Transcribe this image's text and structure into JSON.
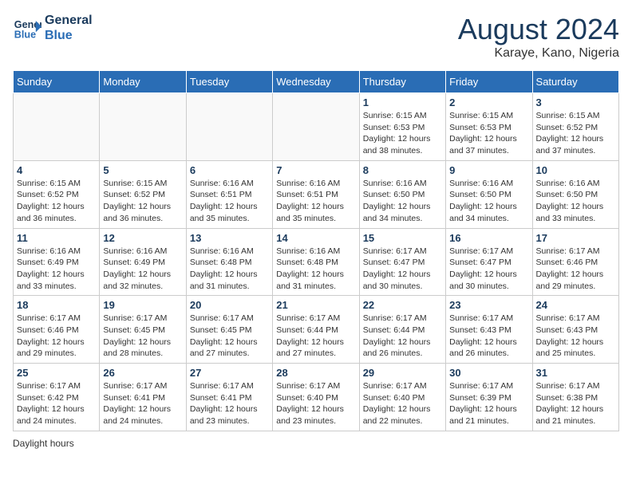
{
  "header": {
    "logo_line1": "General",
    "logo_line2": "Blue",
    "month_year": "August 2024",
    "location": "Karaye, Kano, Nigeria"
  },
  "days_of_week": [
    "Sunday",
    "Monday",
    "Tuesday",
    "Wednesday",
    "Thursday",
    "Friday",
    "Saturday"
  ],
  "weeks": [
    [
      {
        "day": null
      },
      {
        "day": null
      },
      {
        "day": null
      },
      {
        "day": null
      },
      {
        "day": 1,
        "sunrise": "6:15 AM",
        "sunset": "6:53 PM",
        "daylight": "12 hours and 38 minutes."
      },
      {
        "day": 2,
        "sunrise": "6:15 AM",
        "sunset": "6:53 PM",
        "daylight": "12 hours and 37 minutes."
      },
      {
        "day": 3,
        "sunrise": "6:15 AM",
        "sunset": "6:52 PM",
        "daylight": "12 hours and 37 minutes."
      }
    ],
    [
      {
        "day": 4,
        "sunrise": "6:15 AM",
        "sunset": "6:52 PM",
        "daylight": "12 hours and 36 minutes."
      },
      {
        "day": 5,
        "sunrise": "6:15 AM",
        "sunset": "6:52 PM",
        "daylight": "12 hours and 36 minutes."
      },
      {
        "day": 6,
        "sunrise": "6:16 AM",
        "sunset": "6:51 PM",
        "daylight": "12 hours and 35 minutes."
      },
      {
        "day": 7,
        "sunrise": "6:16 AM",
        "sunset": "6:51 PM",
        "daylight": "12 hours and 35 minutes."
      },
      {
        "day": 8,
        "sunrise": "6:16 AM",
        "sunset": "6:50 PM",
        "daylight": "12 hours and 34 minutes."
      },
      {
        "day": 9,
        "sunrise": "6:16 AM",
        "sunset": "6:50 PM",
        "daylight": "12 hours and 34 minutes."
      },
      {
        "day": 10,
        "sunrise": "6:16 AM",
        "sunset": "6:50 PM",
        "daylight": "12 hours and 33 minutes."
      }
    ],
    [
      {
        "day": 11,
        "sunrise": "6:16 AM",
        "sunset": "6:49 PM",
        "daylight": "12 hours and 33 minutes."
      },
      {
        "day": 12,
        "sunrise": "6:16 AM",
        "sunset": "6:49 PM",
        "daylight": "12 hours and 32 minutes."
      },
      {
        "day": 13,
        "sunrise": "6:16 AM",
        "sunset": "6:48 PM",
        "daylight": "12 hours and 31 minutes."
      },
      {
        "day": 14,
        "sunrise": "6:16 AM",
        "sunset": "6:48 PM",
        "daylight": "12 hours and 31 minutes."
      },
      {
        "day": 15,
        "sunrise": "6:17 AM",
        "sunset": "6:47 PM",
        "daylight": "12 hours and 30 minutes."
      },
      {
        "day": 16,
        "sunrise": "6:17 AM",
        "sunset": "6:47 PM",
        "daylight": "12 hours and 30 minutes."
      },
      {
        "day": 17,
        "sunrise": "6:17 AM",
        "sunset": "6:46 PM",
        "daylight": "12 hours and 29 minutes."
      }
    ],
    [
      {
        "day": 18,
        "sunrise": "6:17 AM",
        "sunset": "6:46 PM",
        "daylight": "12 hours and 29 minutes."
      },
      {
        "day": 19,
        "sunrise": "6:17 AM",
        "sunset": "6:45 PM",
        "daylight": "12 hours and 28 minutes."
      },
      {
        "day": 20,
        "sunrise": "6:17 AM",
        "sunset": "6:45 PM",
        "daylight": "12 hours and 27 minutes."
      },
      {
        "day": 21,
        "sunrise": "6:17 AM",
        "sunset": "6:44 PM",
        "daylight": "12 hours and 27 minutes."
      },
      {
        "day": 22,
        "sunrise": "6:17 AM",
        "sunset": "6:44 PM",
        "daylight": "12 hours and 26 minutes."
      },
      {
        "day": 23,
        "sunrise": "6:17 AM",
        "sunset": "6:43 PM",
        "daylight": "12 hours and 26 minutes."
      },
      {
        "day": 24,
        "sunrise": "6:17 AM",
        "sunset": "6:43 PM",
        "daylight": "12 hours and 25 minutes."
      }
    ],
    [
      {
        "day": 25,
        "sunrise": "6:17 AM",
        "sunset": "6:42 PM",
        "daylight": "12 hours and 24 minutes."
      },
      {
        "day": 26,
        "sunrise": "6:17 AM",
        "sunset": "6:41 PM",
        "daylight": "12 hours and 24 minutes."
      },
      {
        "day": 27,
        "sunrise": "6:17 AM",
        "sunset": "6:41 PM",
        "daylight": "12 hours and 23 minutes."
      },
      {
        "day": 28,
        "sunrise": "6:17 AM",
        "sunset": "6:40 PM",
        "daylight": "12 hours and 23 minutes."
      },
      {
        "day": 29,
        "sunrise": "6:17 AM",
        "sunset": "6:40 PM",
        "daylight": "12 hours and 22 minutes."
      },
      {
        "day": 30,
        "sunrise": "6:17 AM",
        "sunset": "6:39 PM",
        "daylight": "12 hours and 21 minutes."
      },
      {
        "day": 31,
        "sunrise": "6:17 AM",
        "sunset": "6:38 PM",
        "daylight": "12 hours and 21 minutes."
      }
    ]
  ],
  "footer": {
    "note": "Daylight hours"
  }
}
